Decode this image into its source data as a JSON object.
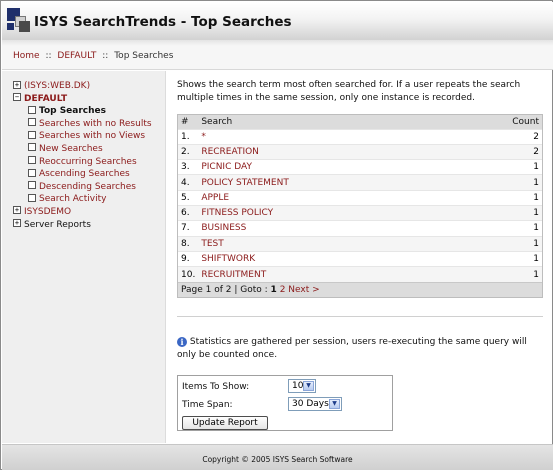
{
  "header": {
    "title": "ISYS SearchTrends - Top Searches"
  },
  "breadcrumb": {
    "home": "Home",
    "sep": "::",
    "default": "DEFAULT",
    "current": "Top Searches"
  },
  "sidebar": {
    "nodes": [
      {
        "label": "(ISYS:WEB.DK)",
        "box": "+",
        "style": "red"
      },
      {
        "label": "DEFAULT",
        "box": "−",
        "style": "red bold"
      },
      {
        "label": "Top Searches",
        "style": "dark bold",
        "child": true
      },
      {
        "label": "Searches with no Results",
        "style": "red",
        "child": true
      },
      {
        "label": "Searches with no Views",
        "style": "red",
        "child": true
      },
      {
        "label": "New Searches",
        "style": "red",
        "child": true
      },
      {
        "label": "Reoccurring Searches",
        "style": "red",
        "child": true
      },
      {
        "label": "Ascending Searches",
        "style": "red",
        "child": true
      },
      {
        "label": "Descending Searches",
        "style": "red",
        "child": true
      },
      {
        "label": "Search Activity",
        "style": "red",
        "child": true
      },
      {
        "label": "ISYSDEMO",
        "box": "+",
        "style": "red"
      },
      {
        "label": "Server Reports",
        "box": "+",
        "style": "dark"
      }
    ]
  },
  "main": {
    "description": "Shows the search term most often searched for. If a user repeats the search multiple times in the same session, only one instance is recorded.",
    "table": {
      "headers": {
        "num": "#",
        "search": "Search",
        "count": "Count"
      },
      "rows": [
        {
          "num": "1.",
          "term": "*",
          "count": "2"
        },
        {
          "num": "2.",
          "term": "RECREATION",
          "count": "2"
        },
        {
          "num": "3.",
          "term": "PICNIC DAY",
          "count": "1"
        },
        {
          "num": "4.",
          "term": "POLICY STATEMENT",
          "count": "1"
        },
        {
          "num": "5.",
          "term": "APPLE",
          "count": "1"
        },
        {
          "num": "6.",
          "term": "FITNESS POLICY",
          "count": "1"
        },
        {
          "num": "7.",
          "term": "BUSINESS",
          "count": "1"
        },
        {
          "num": "8.",
          "term": "TEST",
          "count": "1"
        },
        {
          "num": "9.",
          "term": "SHIFTWORK",
          "count": "1"
        },
        {
          "num": "10.",
          "term": "RECRUITMENT",
          "count": "1"
        }
      ],
      "pager": {
        "text": "Page 1 of 2 | Goto :",
        "page1": "1",
        "page2": "2",
        "next": "Next >"
      }
    },
    "note": "Statistics are gathered per session, users re-executing the same query will only be counted once.",
    "form": {
      "items_label": "Items To Show:",
      "items_value": "10",
      "span_label": "Time Span:",
      "span_value": "30 Days",
      "button": "Update Report"
    }
  },
  "footer": {
    "text": "Copyright © 2005 ISYS Search Software"
  },
  "colors": {
    "link": "#8b1a1a",
    "accent_blue": "#3a66c4"
  }
}
